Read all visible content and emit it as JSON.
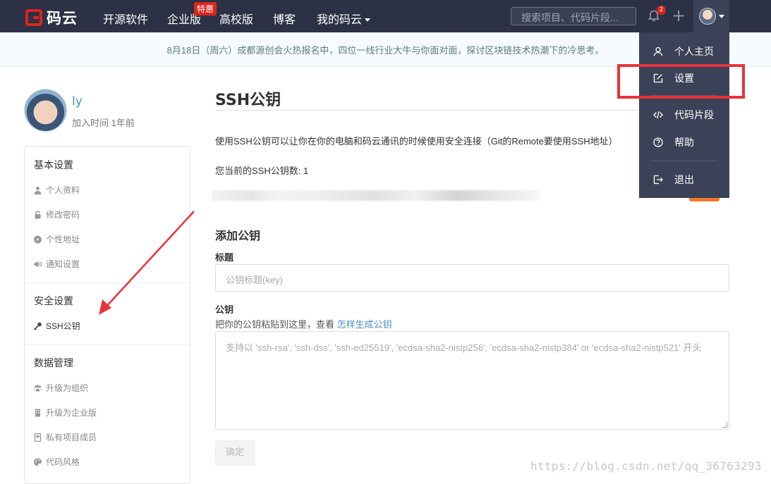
{
  "topbar": {
    "logo_text": "码云",
    "nav": [
      "开源软件",
      "企业版",
      "高校版",
      "博客",
      "我的码云"
    ],
    "hot_badge": "特惠",
    "search_placeholder": "搜索项目、代码片段...",
    "notification_count": "2"
  },
  "announcement": "8月18日（周六）成都源创会火热报名中，四位一线行业大牛与你面对面，探讨区块链技术热潮下的冷思考。",
  "profile": {
    "name": "ly",
    "joined": "加入时间 1年前"
  },
  "sidebar": {
    "basic_title": "基本设置",
    "basic_items": [
      {
        "label": "个人资料",
        "icon": "user-icon"
      },
      {
        "label": "修改密码",
        "icon": "lock-icon"
      },
      {
        "label": "个性地址",
        "icon": "compass-icon"
      },
      {
        "label": "通知设置",
        "icon": "volume-icon"
      }
    ],
    "security_title": "安全设置",
    "security_items": [
      {
        "label": "SSH公钥",
        "icon": "key-icon"
      }
    ],
    "data_title": "数据管理",
    "data_items": [
      {
        "label": "升级为组织",
        "icon": "group-icon"
      },
      {
        "label": "升级为企业版",
        "icon": "building-icon"
      },
      {
        "label": "私有项目成员",
        "icon": "book-icon"
      },
      {
        "label": "代码风格",
        "icon": "palette-icon"
      }
    ]
  },
  "main": {
    "title": "SSH公钥",
    "description": "使用SSH公钥可以让你在你的电脑和码云通讯的时候使用安全连接（Git的Remote要使用SSH地址）",
    "count_text": "您当前的SSH公钥数: 1",
    "add_title": "添加公钥",
    "title_label": "标题",
    "title_placeholder": "公钥标题(key)",
    "key_label": "公钥",
    "key_hint": "把你的公钥粘贴到这里，查看 ",
    "key_hint_link": "怎样生成公钥",
    "key_placeholder": "支持以 'ssh-rsa', 'ssh-dss', 'ssh-ed25519', 'ecdsa-sha2-nistp256', 'ecdsa-sha2-nistp384' or 'ecdsa-sha2-nistp521' 开头",
    "confirm_label": "确定"
  },
  "dropdown": {
    "items": [
      {
        "label": "个人主页",
        "icon": "user-icon"
      },
      {
        "label": "设置",
        "icon": "edit-icon"
      },
      {
        "label": "代码片段",
        "icon": "code-icon"
      },
      {
        "label": "帮助",
        "icon": "help-icon"
      },
      {
        "label": "退出",
        "icon": "logout-icon"
      }
    ]
  },
  "watermark": "https://blog.csdn.net/qq_36763293",
  "colors": {
    "topbar": "#2c3145",
    "dropdown": "#3b4257",
    "brand_red": "#d9261c",
    "highlight_red": "#e8323a",
    "link_blue": "#4a90c2"
  }
}
